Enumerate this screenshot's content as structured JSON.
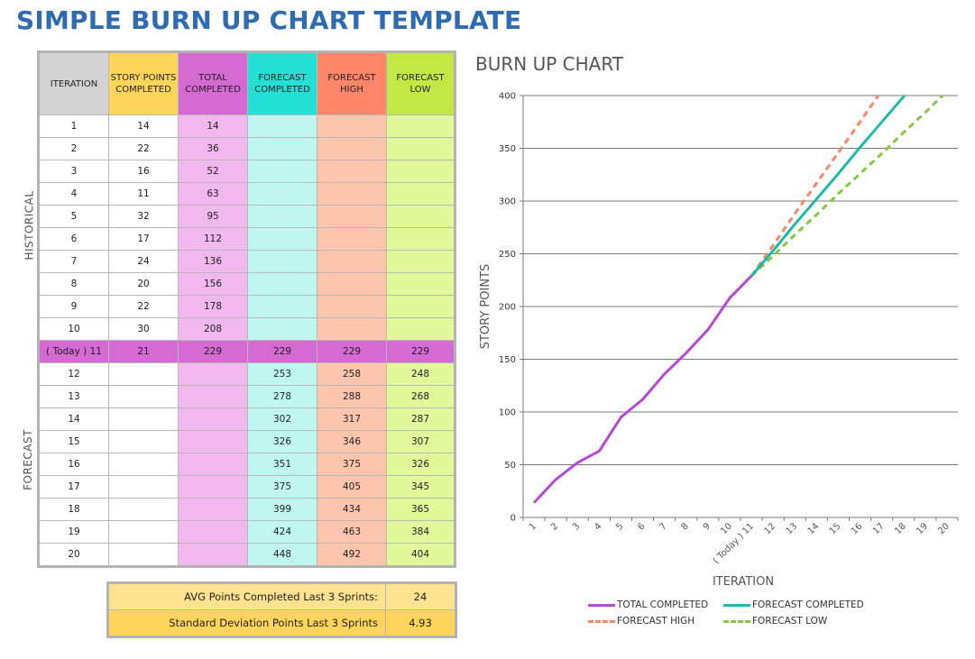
{
  "page_title": "SIMPLE BURN UP CHART TEMPLATE",
  "section_labels": {
    "historical": "HISTORICAL",
    "forecast": "FORECAST"
  },
  "table": {
    "headers": [
      "ITERATION",
      "STORY POINTS COMPLETED",
      "TOTAL COMPLETED",
      "FORECAST COMPLETED",
      "FORECAST HIGH",
      "FORECAST LOW"
    ],
    "rows": [
      [
        "1",
        "14",
        "14",
        "",
        "",
        ""
      ],
      [
        "2",
        "22",
        "36",
        "",
        "",
        ""
      ],
      [
        "3",
        "16",
        "52",
        "",
        "",
        ""
      ],
      [
        "4",
        "11",
        "63",
        "",
        "",
        ""
      ],
      [
        "5",
        "32",
        "95",
        "",
        "",
        ""
      ],
      [
        "6",
        "17",
        "112",
        "",
        "",
        ""
      ],
      [
        "7",
        "24",
        "136",
        "",
        "",
        ""
      ],
      [
        "8",
        "20",
        "156",
        "",
        "",
        ""
      ],
      [
        "9",
        "22",
        "178",
        "",
        "",
        ""
      ],
      [
        "10",
        "30",
        "208",
        "",
        "",
        ""
      ],
      [
        "( Today ) 11",
        "21",
        "229",
        "229",
        "229",
        "229"
      ],
      [
        "12",
        "",
        "",
        "253",
        "258",
        "248"
      ],
      [
        "13",
        "",
        "",
        "278",
        "288",
        "268"
      ],
      [
        "14",
        "",
        "",
        "302",
        "317",
        "287"
      ],
      [
        "15",
        "",
        "",
        "326",
        "346",
        "307"
      ],
      [
        "16",
        "",
        "",
        "351",
        "375",
        "326"
      ],
      [
        "17",
        "",
        "",
        "375",
        "405",
        "345"
      ],
      [
        "18",
        "",
        "",
        "399",
        "434",
        "365"
      ],
      [
        "19",
        "",
        "",
        "424",
        "463",
        "384"
      ],
      [
        "20",
        "",
        "",
        "448",
        "492",
        "404"
      ]
    ],
    "today_row_index": 10
  },
  "stats": {
    "avg_label": "AVG Points Completed Last 3 Sprints:",
    "avg_value": "24",
    "std_label": "Standard Deviation Points Last 3 Sprints",
    "std_value": "4.93"
  },
  "colors": {
    "title": "#2e6bb0",
    "total_completed": "#b548d6",
    "forecast_completed": "#1fb8ad",
    "forecast_high": "#ff8466",
    "forecast_low": "#86c93d"
  },
  "chart_data": {
    "type": "line",
    "title": "BURN UP CHART",
    "xlabel": "ITERATION",
    "ylabel": "STORY POINTS",
    "categories": [
      "1",
      "2",
      "3",
      "4",
      "5",
      "6",
      "7",
      "8",
      "9",
      "10",
      "( Today ) 11",
      "12",
      "13",
      "14",
      "15",
      "16",
      "17",
      "18",
      "19",
      "20"
    ],
    "ylim": [
      0,
      400
    ],
    "yticks": [
      0,
      50,
      100,
      150,
      200,
      250,
      300,
      350,
      400
    ],
    "grid": true,
    "legend_position": "bottom",
    "series": [
      {
        "name": "TOTAL COMPLETED",
        "style": "solid",
        "color": "#b548d6",
        "values": [
          14,
          36,
          52,
          63,
          95,
          112,
          136,
          156,
          178,
          208,
          229,
          null,
          null,
          null,
          null,
          null,
          null,
          null,
          null,
          null
        ]
      },
      {
        "name": "FORECAST COMPLETED",
        "style": "solid",
        "color": "#1fb8ad",
        "values": [
          null,
          null,
          null,
          null,
          null,
          null,
          null,
          null,
          null,
          null,
          229,
          253,
          278,
          302,
          326,
          351,
          375,
          399,
          424,
          448
        ]
      },
      {
        "name": "FORECAST HIGH",
        "style": "dashed",
        "color": "#ff8466",
        "values": [
          null,
          null,
          null,
          null,
          null,
          null,
          null,
          null,
          null,
          null,
          229,
          258,
          288,
          317,
          346,
          375,
          405,
          434,
          463,
          492
        ]
      },
      {
        "name": "FORECAST LOW",
        "style": "dashed",
        "color": "#86c93d",
        "values": [
          null,
          null,
          null,
          null,
          null,
          null,
          null,
          null,
          null,
          null,
          229,
          248,
          268,
          287,
          307,
          326,
          345,
          365,
          384,
          404
        ]
      }
    ]
  }
}
